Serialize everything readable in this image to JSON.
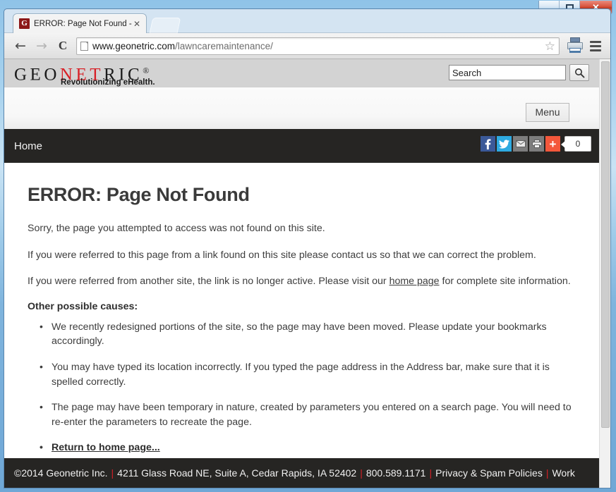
{
  "window": {
    "minimize_label": "minimize",
    "maximize_label": "maximize",
    "close_label": "✕"
  },
  "browser": {
    "tab": {
      "favicon_letter": "G",
      "title": "ERROR: Page Not Found -",
      "close_label": "✕"
    },
    "toolbar": {
      "back_label": "←",
      "forward_label": "→",
      "reload_label": "C",
      "url_host": "www.geonetric.com",
      "url_path": "/lawncaremaintenance/",
      "star_label": "☆"
    }
  },
  "site": {
    "logo": {
      "part1": "GEO",
      "part2": "NET",
      "part3": "RIC",
      "registered": "®",
      "tagline": "Revolutionizing eHealth."
    },
    "search": {
      "value": "Search",
      "placeholder": "Search",
      "button_label": "search-icon"
    },
    "menu_button_label": "Menu",
    "nav": {
      "home_label": "Home",
      "share_count": "0"
    }
  },
  "content": {
    "title": "ERROR: Page Not Found",
    "paragraph1": "Sorry, the page you attempted to access was not found on this site.",
    "paragraph2": "If you were referred to this page from a link found on this site please contact us so that we can correct the problem.",
    "paragraph3_before": "If you were referred from another site, the link is no longer active. Please visit our ",
    "paragraph3_link": "home page",
    "paragraph3_after": " for complete site information.",
    "causes_heading": "Other possible causes:",
    "causes": [
      "We recently redesigned portions of the site, so the page may have been moved. Please update your bookmarks accordingly.",
      "You may have typed its location incorrectly. If you typed the page address in the Address bar, make sure that it is spelled correctly.",
      "The page may have been temporary in nature, created by parameters you entered on a search page. You will need to re-enter the parameters to recreate the page."
    ],
    "return_link": "Return to home page..."
  },
  "footer": {
    "copyright": "©2014 Geonetric Inc.",
    "address": "4211 Glass Road NE, Suite A, Cedar Rapids, IA 52402",
    "phone": "800.589.1171",
    "privacy_link": "Privacy & Spam Policies",
    "work_link": "Work",
    "separator": "|"
  },
  "colors": {
    "brand_red": "#d81f26",
    "nav_dark": "#262523",
    "header_gray": "#d3d3d3",
    "facebook": "#3b5998",
    "twitter": "#2eaae1",
    "share_plus": "#f4573b"
  }
}
